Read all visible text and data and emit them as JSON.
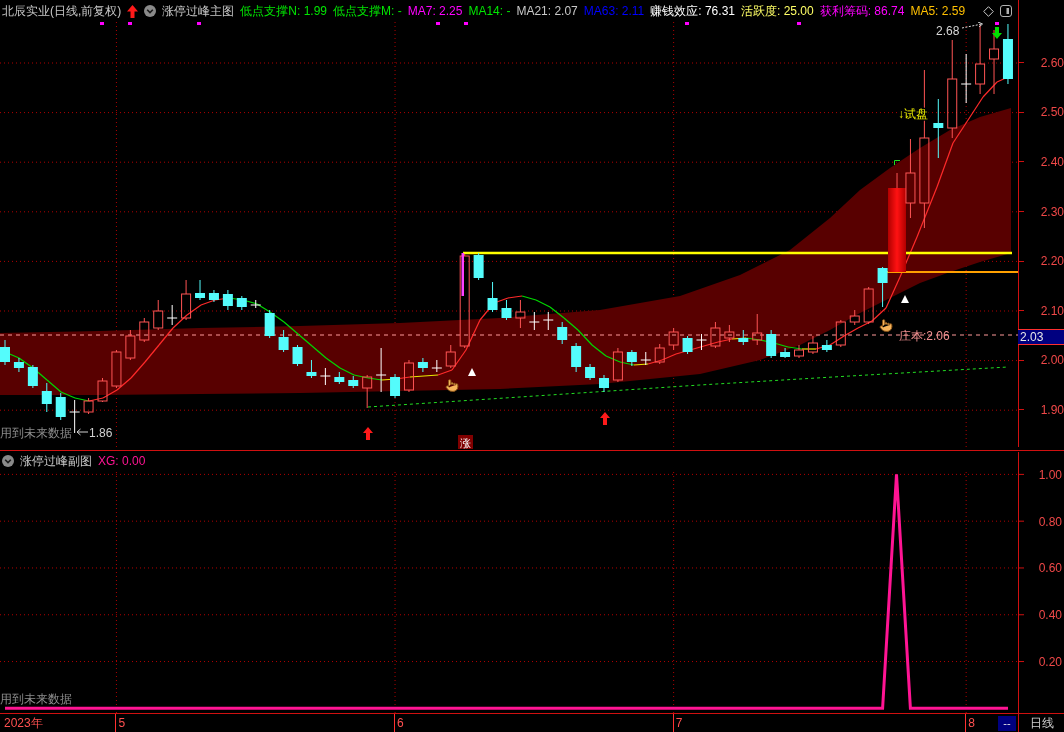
{
  "header": {
    "title": "北辰实业(日线,前复权)",
    "indicator_name": "涨停过峰主图",
    "indicators": [
      {
        "text": "低点支撑N: 1.99",
        "color": "#00e600"
      },
      {
        "text": "低点支撑M: -",
        "color": "#00e600"
      },
      {
        "text": "MA7: 2.25",
        "color": "#ff00ff"
      },
      {
        "text": "MA14: -",
        "color": "#00e600"
      },
      {
        "text": "MA21: 2.07",
        "color": "#c8c8c8"
      },
      {
        "text": "MA63: 2.11",
        "color": "#0000ff"
      },
      {
        "text": "赚钱效应: 76.31",
        "color": "#ffffff"
      },
      {
        "text": "活跃度: 25.00",
        "color": "#ffff66"
      },
      {
        "text": "获利筹码: 86.74",
        "color": "#ff00ff"
      },
      {
        "text": "MA5: 2.59",
        "color": "#ffc000"
      }
    ]
  },
  "main_chart": {
    "peak_label": "2.68",
    "signal_label": "↓试盘",
    "cost_label": "庄本:2.06",
    "future_data_note": "用到未来数据",
    "low_label": "1.86",
    "limit_up_badge": "涨",
    "price_axis": [
      "2.60",
      "2.50",
      "2.40",
      "2.30",
      "2.20",
      "2.10",
      "2.00",
      "1.90"
    ],
    "current_price": "2.03"
  },
  "sub_chart": {
    "title": "涨停过峰副图",
    "readout": ": 0.00",
    "future_data_note": "用到未来数据",
    "chart_data": {
      "type": "line",
      "ylim": [
        -0.02,
        1.1
      ],
      "grid": true,
      "yticks": [
        {
          "value": 1,
          "label": "1.00"
        },
        {
          "value": 0.8,
          "label": "0.80"
        },
        {
          "value": 0.6,
          "label": "0.60"
        },
        {
          "value": 0.4,
          "label": "0.40"
        },
        {
          "value": 0.2,
          "label": "0.20"
        }
      ],
      "series": [
        {
          "name": "XG",
          "color": "#ff1493",
          "values": [
            0,
            0,
            0,
            0,
            0,
            0,
            0,
            0,
            0,
            0,
            0,
            0,
            0,
            0,
            0,
            0,
            0,
            0,
            0,
            0,
            0,
            0,
            0,
            0,
            0,
            0,
            0,
            0,
            0,
            0,
            0,
            0,
            0,
            0,
            0,
            0,
            0,
            0,
            0,
            0,
            0,
            0,
            0,
            0,
            0,
            0,
            0,
            0,
            0,
            0,
            0,
            0,
            0,
            0,
            0,
            0,
            0,
            0,
            0,
            0,
            0,
            0,
            0,
            0,
            1,
            0,
            0,
            0,
            0,
            0,
            0,
            0,
            0
          ]
        }
      ]
    }
  },
  "time_axis": {
    "year": "2023年",
    "months": [
      "5",
      "6",
      "7",
      "8"
    ],
    "button": "--",
    "period": "日线"
  }
}
